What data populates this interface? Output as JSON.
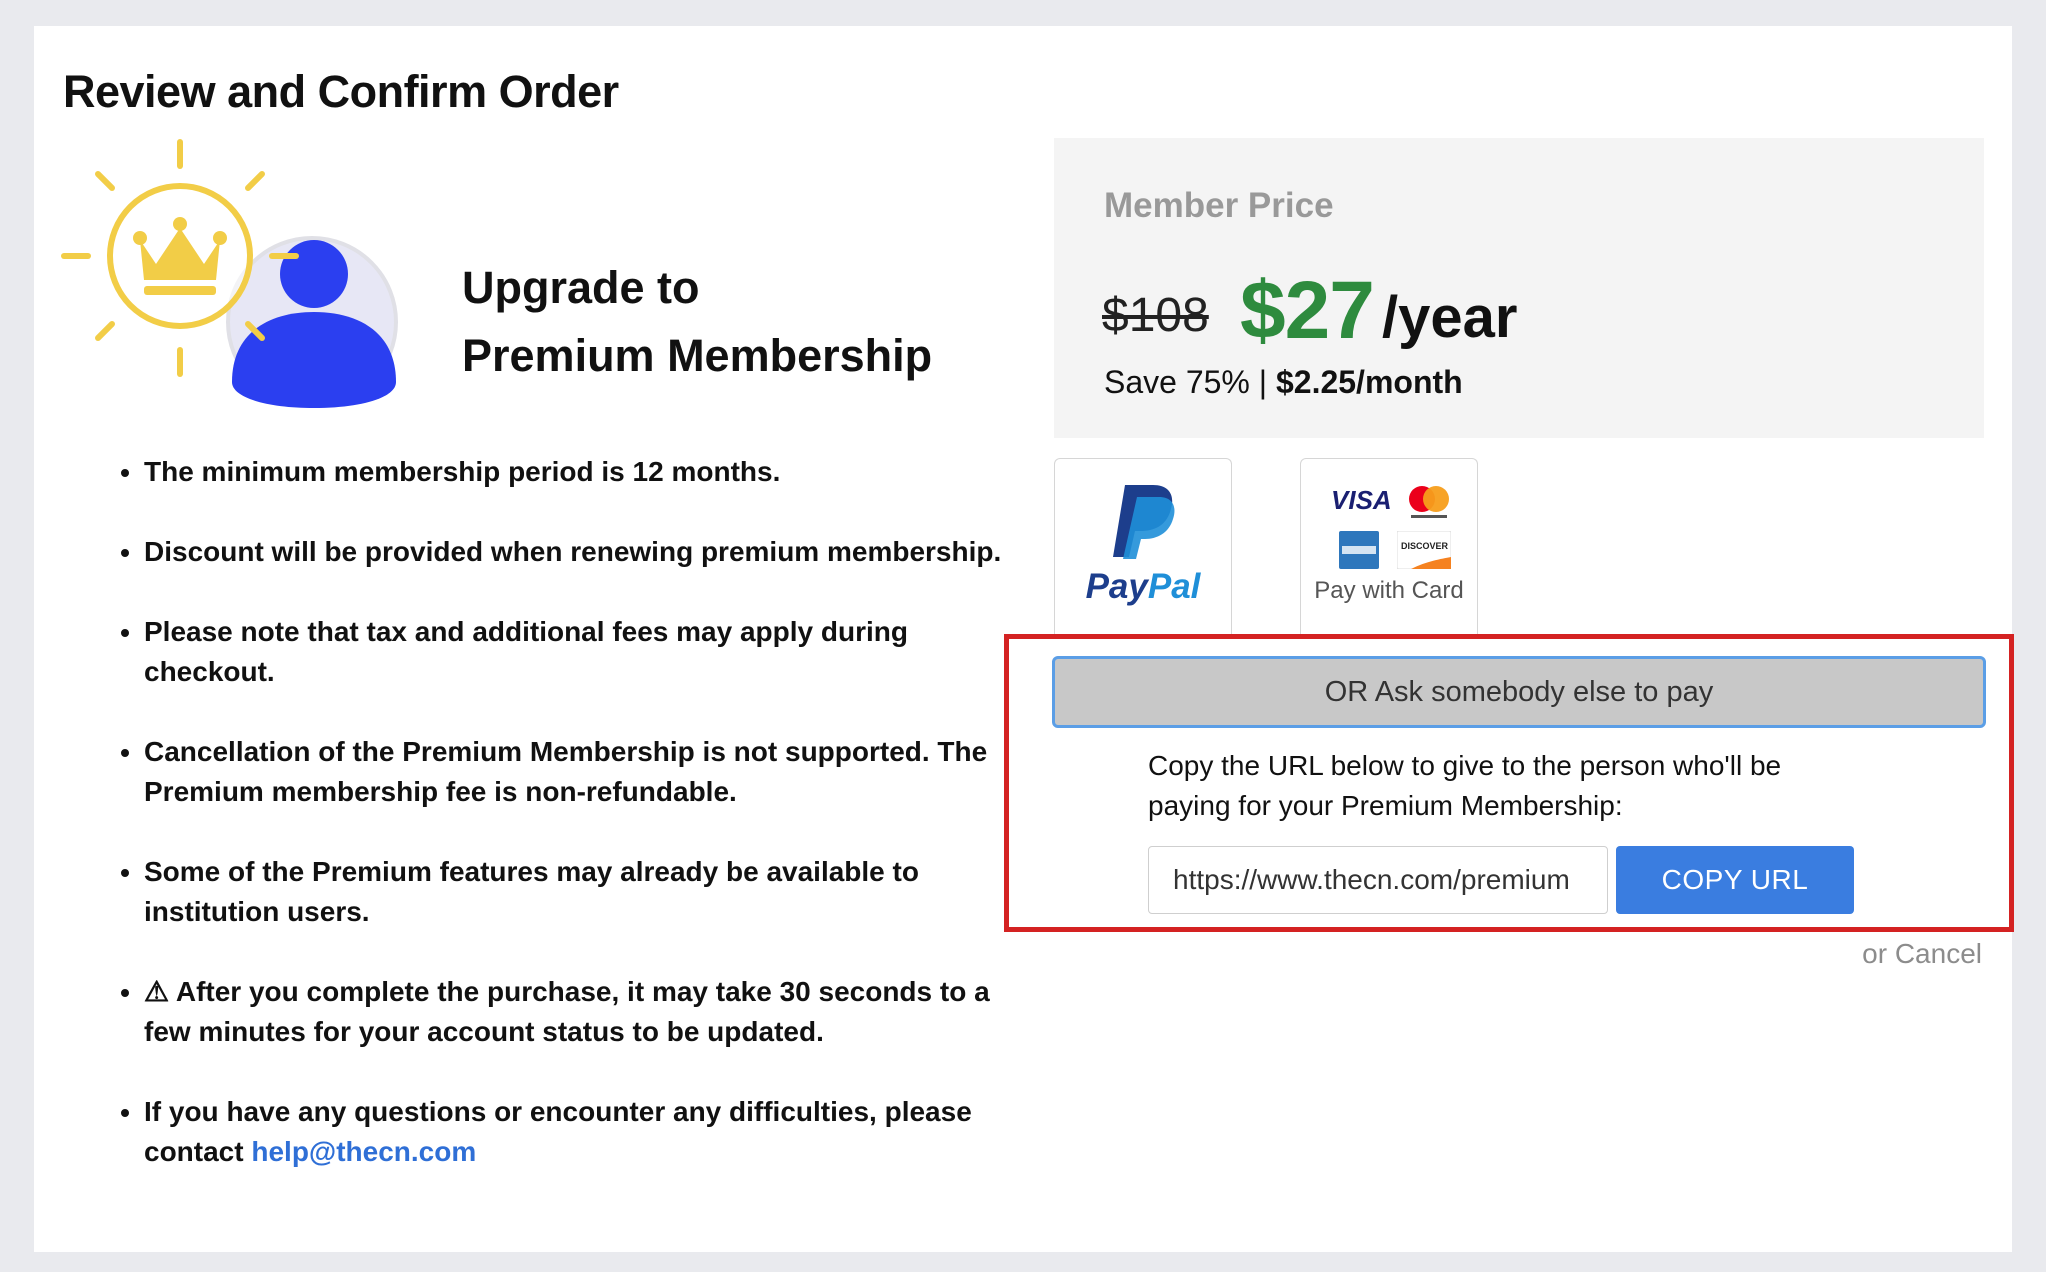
{
  "page": {
    "title": "Review and Confirm Order"
  },
  "hero": {
    "line1": "Upgrade to",
    "line2": "Premium Membership"
  },
  "benefits": [
    "The minimum membership period is 12 months.",
    "Discount will be provided when renewing premium membership.",
    "Please note that tax and additional fees may apply during checkout.",
    "Cancellation of the Premium Membership is not supported. The Premium membership fee is non-refundable.",
    "Some of the Premium features may already be available to institution users.",
    "⚠ After you complete the purchase, it may take 30 seconds to a few minutes for your account status to be updated.",
    "If you have any questions or encounter any difficulties, please contact"
  ],
  "contact": {
    "email": "help@thecn.com"
  },
  "pricing": {
    "label": "Member Price",
    "old_price": "$108",
    "new_price": "$27",
    "period": "/year",
    "save_text": "Save 75% | ",
    "monthly": "$2.25/month"
  },
  "payment_methods": {
    "paypal": {
      "label_pay": "Pay",
      "label_pal": "Pal",
      "icon": "paypal-logo"
    },
    "card": {
      "label": "Pay with Card",
      "brands": [
        "VISA",
        "mastercard",
        "AMERICAN EXPRESS",
        "DISCOVER"
      ]
    }
  },
  "share": {
    "ask_button": "OR Ask somebody else to pay",
    "description": "Copy the URL below to give to the person who'll be paying for your Premium Membership:",
    "url_value": "https://www.thecn.com/premium",
    "copy_button": "COPY URL"
  },
  "cancel": {
    "label": "or Cancel"
  },
  "colors": {
    "price_green": "#2e8b3e",
    "link_blue": "#2f6fd6",
    "button_blue": "#3a7de0",
    "highlight_red": "#d42222",
    "crown_yellow": "#f2cd47",
    "avatar_blue": "#2b3ff0"
  }
}
